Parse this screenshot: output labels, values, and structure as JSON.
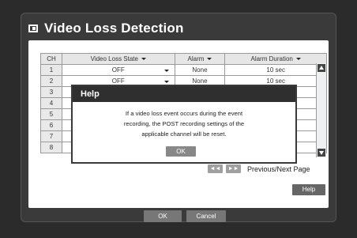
{
  "window": {
    "title": "Video Loss Detection"
  },
  "table": {
    "headers": [
      "CH",
      "Video Loss State",
      "Alarm",
      "Alarm Duration"
    ],
    "rows": [
      {
        "ch": "1",
        "state": "OFF",
        "alarm": "None",
        "duration": "10 sec"
      },
      {
        "ch": "2",
        "state": "OFF",
        "alarm": "None",
        "duration": "10 sec"
      },
      {
        "ch": "3",
        "state": "",
        "alarm": "",
        "duration": ""
      },
      {
        "ch": "4",
        "state": "",
        "alarm": "",
        "duration": ""
      },
      {
        "ch": "5",
        "state": "",
        "alarm": "",
        "duration": ""
      },
      {
        "ch": "6",
        "state": "",
        "alarm": "",
        "duration": ""
      },
      {
        "ch": "7",
        "state": "",
        "alarm": "",
        "duration": ""
      },
      {
        "ch": "8",
        "state": "",
        "alarm": "",
        "duration": ""
      }
    ]
  },
  "pager": {
    "prev_icon": "rewind-icon",
    "next_icon": "fast-forward-icon",
    "prev_glyph": "◄◄",
    "next_glyph": "►►",
    "label": "Previous/Next Page"
  },
  "buttons": {
    "help": "Help",
    "ok": "OK",
    "cancel": "Cancel"
  },
  "dialog": {
    "title": "Help",
    "lines": [
      "If a video loss event occurs during the event",
      "recording, the POST recording settings of the",
      "applicable channel will be reset."
    ],
    "ok": "OK"
  }
}
